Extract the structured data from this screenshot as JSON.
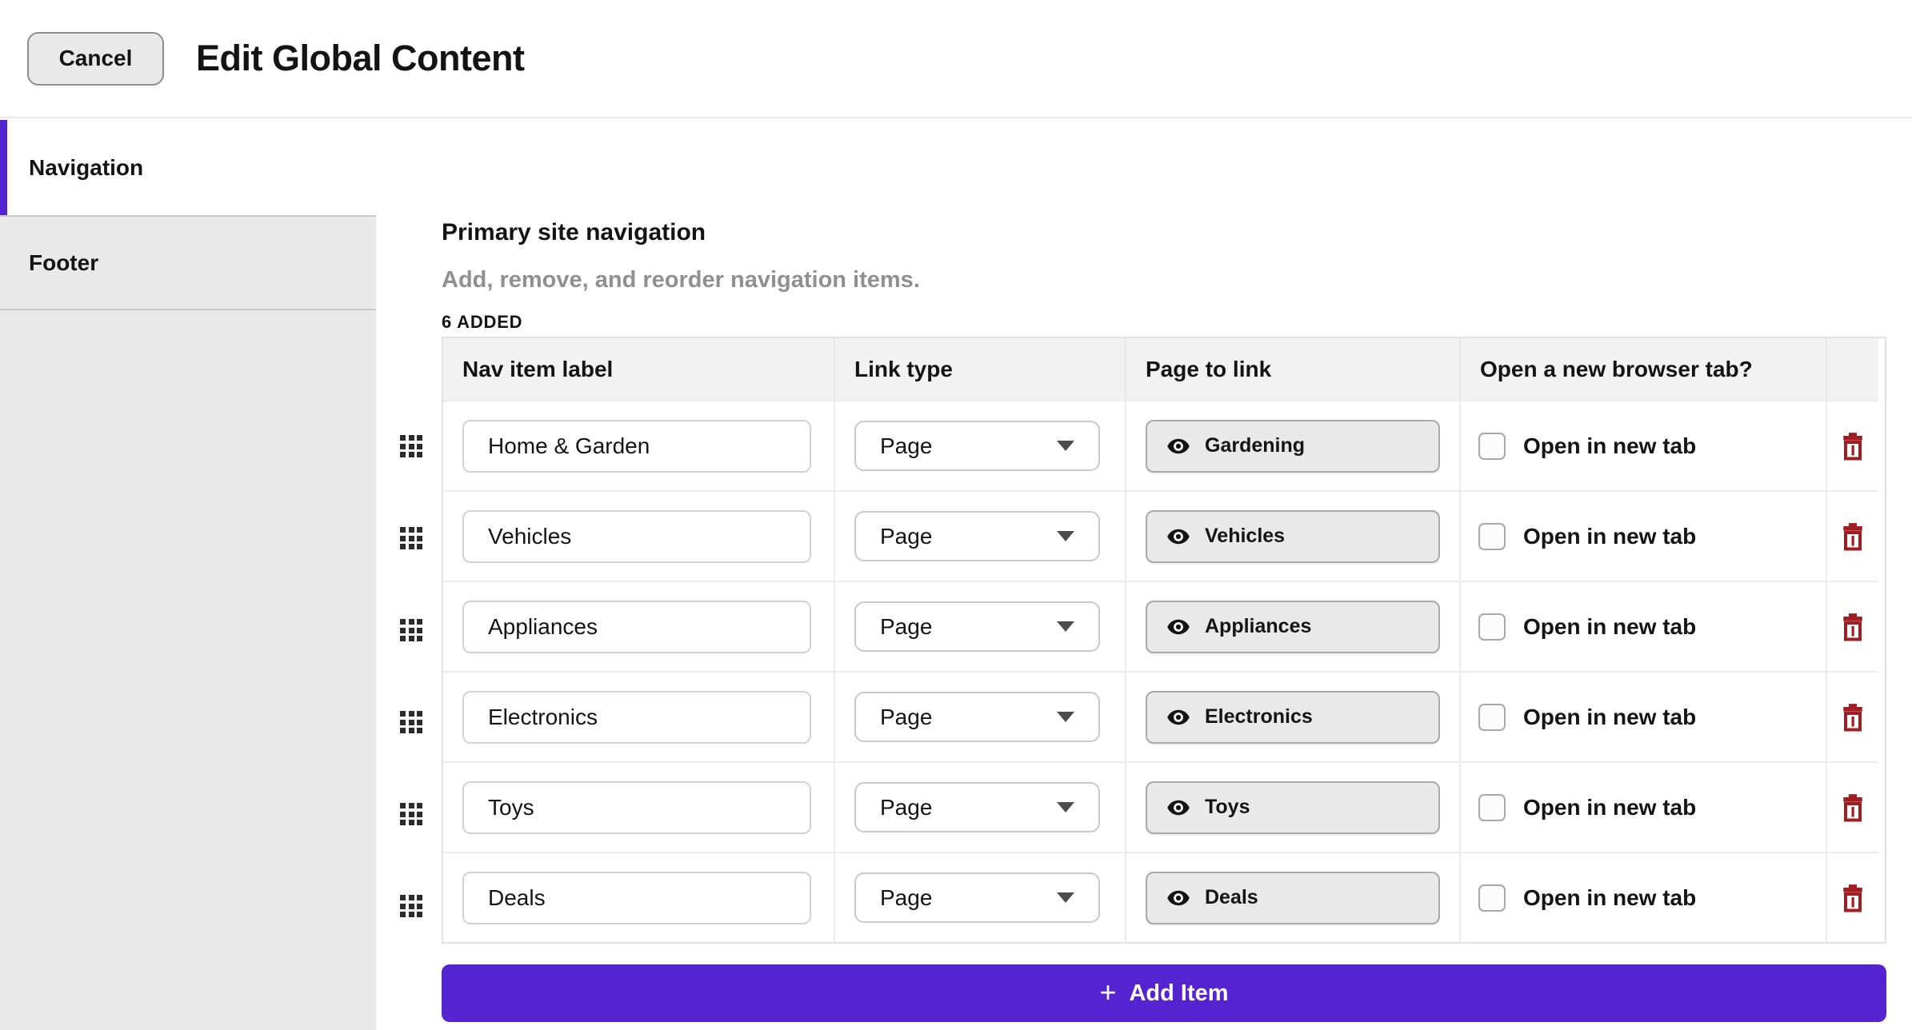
{
  "header": {
    "cancel_label": "Cancel",
    "title": "Edit Global Content"
  },
  "sidebar": {
    "items": [
      {
        "label": "Navigation",
        "active": true
      },
      {
        "label": "Footer",
        "active": false
      }
    ]
  },
  "section": {
    "title": "Primary site navigation",
    "description": "Add, remove, and reorder navigation items.",
    "count_label": "6 ADDED"
  },
  "table": {
    "columns": [
      "Nav item label",
      "Link type",
      "Page to link",
      "Open a new browser tab?"
    ],
    "new_tab_label": "Open in new tab",
    "rows": [
      {
        "label": "Home & Garden",
        "link_type": "Page",
        "page": "Gardening",
        "new_tab_checked": false
      },
      {
        "label": "Vehicles",
        "link_type": "Page",
        "page": "Vehicles",
        "new_tab_checked": false
      },
      {
        "label": "Appliances",
        "link_type": "Page",
        "page": "Appliances",
        "new_tab_checked": false
      },
      {
        "label": "Electronics",
        "link_type": "Page",
        "page": "Electronics",
        "new_tab_checked": false
      },
      {
        "label": "Toys",
        "link_type": "Page",
        "page": "Toys",
        "new_tab_checked": false
      },
      {
        "label": "Deals",
        "link_type": "Page",
        "page": "Deals",
        "new_tab_checked": false
      }
    ]
  },
  "add_item": {
    "plus": "+",
    "label": "Add Item"
  },
  "colors": {
    "accent": "#5523d0",
    "danger": "#a21d21",
    "sidebar_bg": "#e9e9e9",
    "header_bg": "#f2f2f2"
  }
}
